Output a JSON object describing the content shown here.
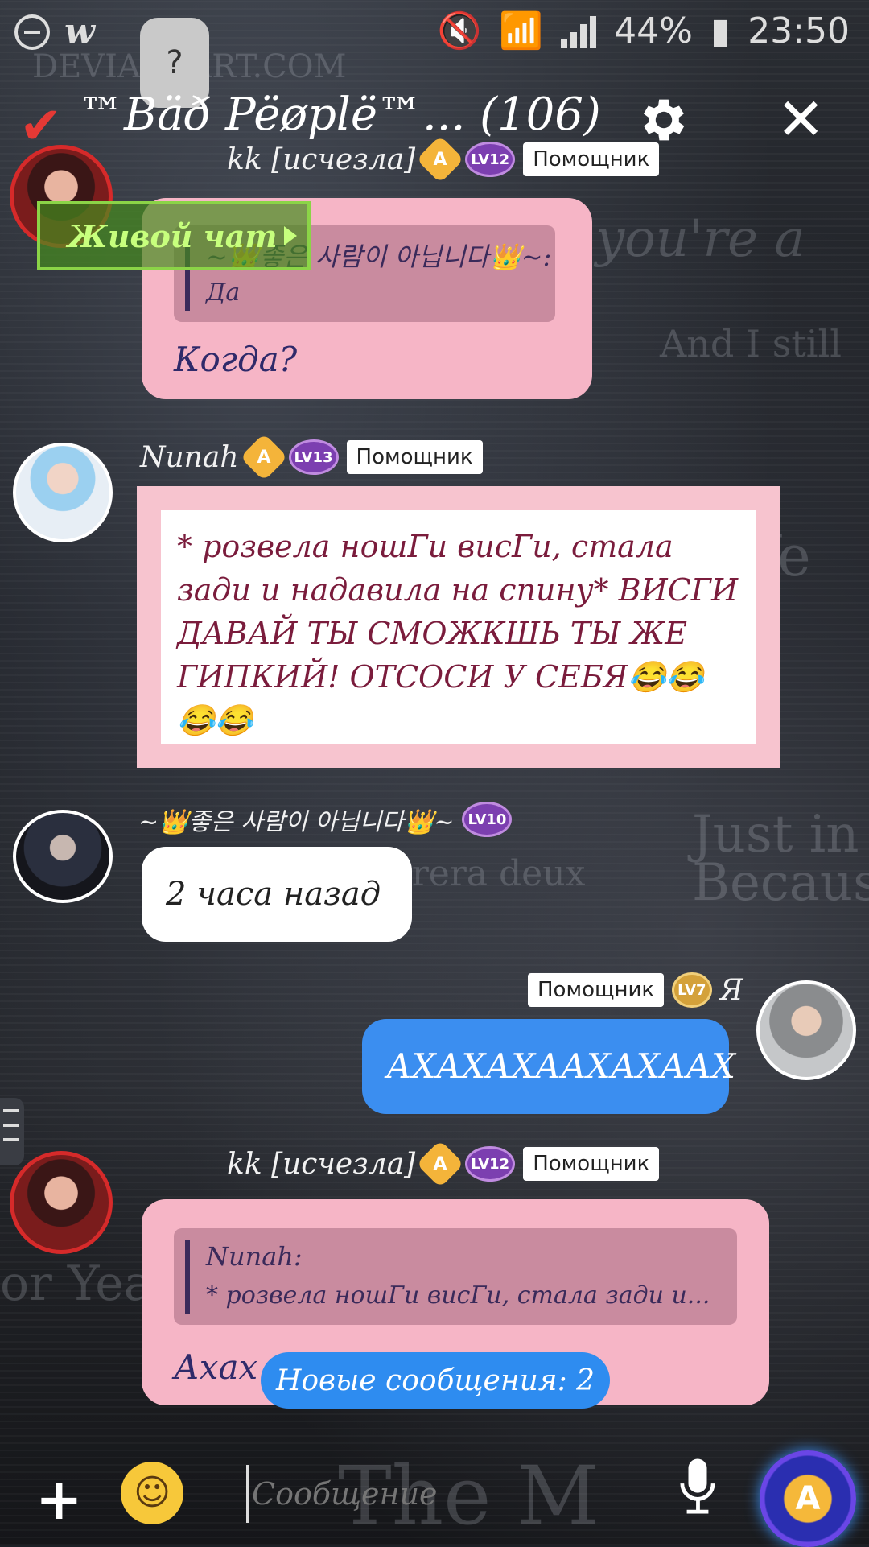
{
  "status_bar": {
    "battery": "44%",
    "time": "23:50"
  },
  "help_button": "?",
  "header": {
    "title": "™Bäð Pëøplë™...  (106)"
  },
  "live_chat_label": "Живой чат",
  "messages": [
    {
      "author": "kk  [исчезла]",
      "level": "LV12",
      "role": "Помощник",
      "quote_author": "~👑좋은 사람이 아닙니다👑~:",
      "quote_text": "Да",
      "text": "Когда?"
    },
    {
      "author": "Nunah",
      "level": "LV13",
      "role": "Помощник",
      "text": "* розвела ношГи висГи, стала зади и надавила на спину* ВИСГИ ДАВАЙ ТЫ СМОЖКШЬ ТЫ ЖЕ ГИПКИЙ! ОТСОСИ У СЕБЯ😂😂 😂😂"
    },
    {
      "author": "~👑좋은 사람이 아닙니다👑~",
      "level": "LV10",
      "text": "2 часа назад"
    },
    {
      "author": "Я",
      "level": "LV7",
      "role": "Помощник",
      "text": "АХАХАХААХАХААХ"
    },
    {
      "author": "kk  [исчезла]",
      "level": "LV12",
      "role": "Помощник",
      "quote_author": "Nunah:",
      "quote_text": "* розвела ношГи висГи, стала зади и...",
      "text": "Ахах"
    }
  ],
  "new_messages": "Новые сообщения: 2",
  "composer": {
    "placeholder": "Сообщение"
  },
  "colors": {
    "pink_bubble": "#f6b5c6",
    "blue_bubble": "#3b8ef0",
    "accent_red": "#d62a2a",
    "live_green": "#8bd447"
  }
}
